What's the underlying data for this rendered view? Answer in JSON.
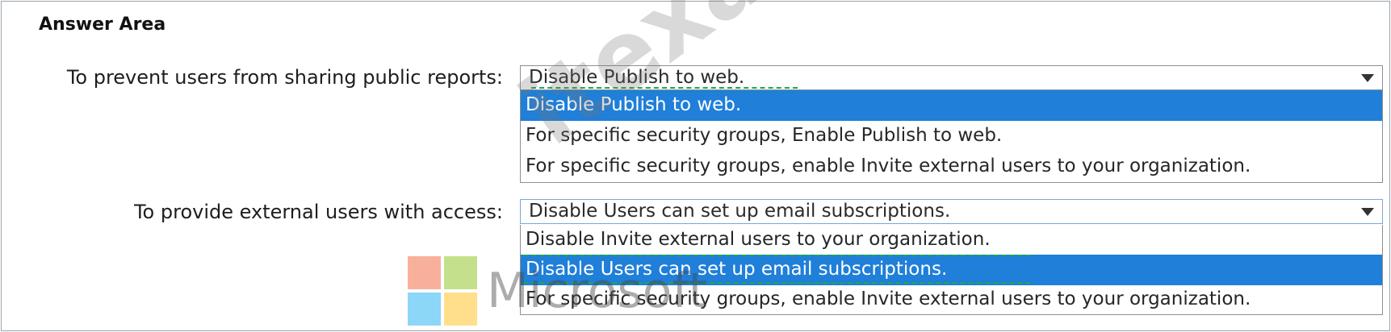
{
  "title": "Answer Area",
  "questions": [
    {
      "label": "To prevent users from sharing public reports:",
      "selected": "Disable Publish to web.",
      "options": [
        "Disable Publish to web.",
        "For specific security groups, Enable Publish to web.",
        "For specific security groups, enable Invite external users to your organization."
      ],
      "highlighted_index": 0
    },
    {
      "label": "To provide external users with access:",
      "selected": "Disable Users can set up email subscriptions.",
      "options": [
        "Disable Invite external users to your organization.",
        "Disable Users can set up email subscriptions.",
        "For specific security groups, enable Invite external users to your organization."
      ],
      "highlighted_index": 1
    }
  ],
  "watermark": "itexam.net",
  "logo_text": "Microsoft",
  "colors": {
    "highlight": "#1f7fd9",
    "answer_dash": "#1ea84a"
  },
  "icons": {
    "dropdown": "chevron-down-icon"
  }
}
